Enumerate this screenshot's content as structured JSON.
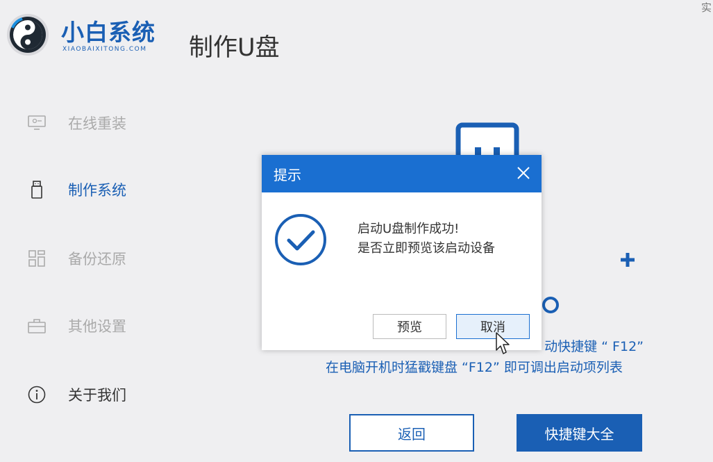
{
  "header": {
    "logo_name": "小白系统",
    "logo_sub": "XIAOBAIXITONG.COM",
    "page_title": "制作U盘",
    "corner_text": "实"
  },
  "sidebar": {
    "items": [
      {
        "label": "在线重装",
        "icon": "monitor-icon",
        "state": "inactive"
      },
      {
        "label": "制作系统",
        "icon": "usb-drive-icon",
        "state": "active"
      },
      {
        "label": "备份还原",
        "icon": "grid-icon",
        "state": "inactive"
      },
      {
        "label": "其他设置",
        "icon": "briefcase-icon",
        "state": "inactive"
      },
      {
        "label": "关于我们",
        "icon": "info-icon",
        "state": "normal"
      }
    ]
  },
  "main": {
    "hint_line1": "动快捷键 “ F12”",
    "hint_line2": "在电脑开机时猛戳键盘 “F12” 即可调出启动项列表",
    "back_button": "返回",
    "shortcut_button": "快捷键大全"
  },
  "dialog": {
    "title": "提示",
    "message_line1": "启动U盘制作成功!",
    "message_line2": "是否立即预览该启动设备",
    "preview_button": "预览",
    "cancel_button": "取消"
  },
  "colors": {
    "brand_blue": "#1a5fb4",
    "dialog_header": "#1a6fd1",
    "background": "#efeff1"
  }
}
